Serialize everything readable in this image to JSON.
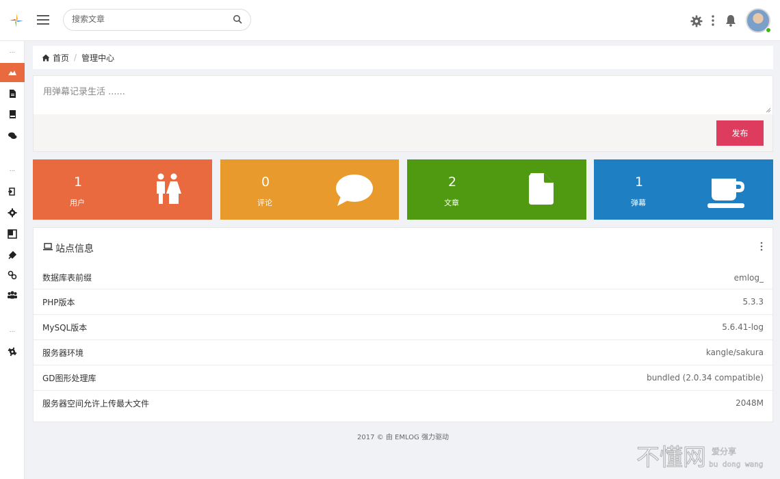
{
  "search": {
    "placeholder": "搜索文章"
  },
  "breadcrumb": {
    "home": "首页",
    "current": "管理中心"
  },
  "twitter": {
    "placeholder": "用弹幕记录生活 ......",
    "publish_label": "发布"
  },
  "stats": [
    {
      "value": "1",
      "label": "用户",
      "color": "#e96a3f",
      "icon": "users-icon"
    },
    {
      "value": "0",
      "label": "评论",
      "color": "#e99a2c",
      "icon": "comment-icon"
    },
    {
      "value": "2",
      "label": "文章",
      "color": "#4f9a10",
      "icon": "file-icon"
    },
    {
      "value": "1",
      "label": "弹幕",
      "color": "#1e7fc2",
      "icon": "coffee-icon"
    }
  ],
  "site_info": {
    "title": "站点信息",
    "rows": [
      {
        "key": "数据库表前缀",
        "value": "emlog_"
      },
      {
        "key": "PHP版本",
        "value": "5.3.3"
      },
      {
        "key": "MySQL版本",
        "value": "5.6.41-log"
      },
      {
        "key": "服务器环境",
        "value": "kangle/sakura"
      },
      {
        "key": "GD图形处理库",
        "value": "bundled (2.0.34 compatible)"
      },
      {
        "key": "服务器空间允许上传最大文件",
        "value": "2048M"
      }
    ]
  },
  "sidebar": {
    "separator": "...",
    "items": [
      "home-icon",
      "file-icon",
      "book-icon",
      "comments-icon",
      "signout-icon",
      "gear-icon",
      "layout-icon",
      "plugin-icon",
      "link-icon",
      "users-icon",
      "cog-icon"
    ]
  },
  "footer": {
    "text": "2017 © 由 EMLOG 强力驱动"
  },
  "watermark": {
    "main": "不懂网",
    "sub": "爱分享",
    "pinyin": "bu dong wang"
  },
  "colors": {
    "accent": "#e96a3f",
    "publish": "#dd3c5f"
  }
}
